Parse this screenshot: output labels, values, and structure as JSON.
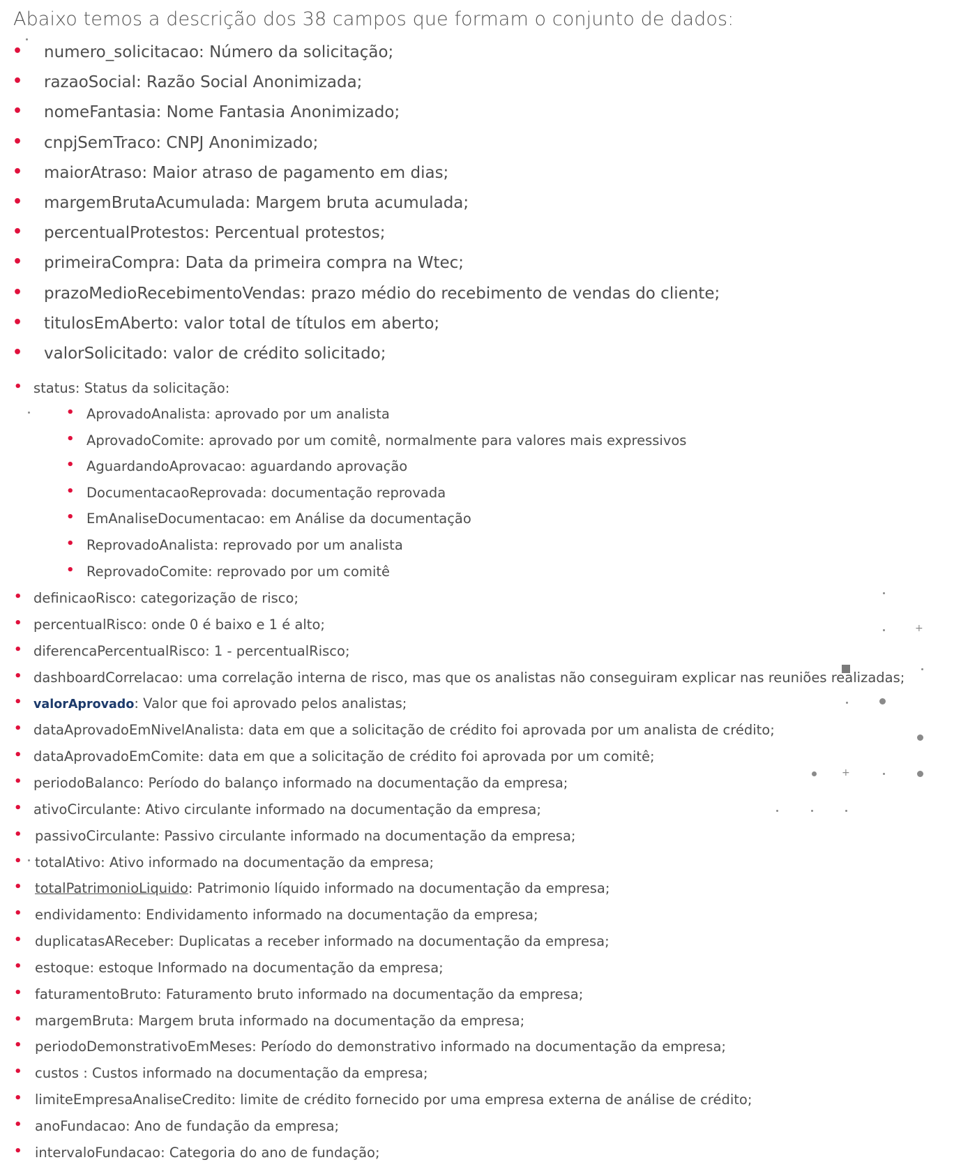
{
  "title": "Abaixo temos a descrição dos 38 campos que formam o conjunto de dados:",
  "main_fields": [
    {
      "key": "numero_solicitacao",
      "desc": ": Número da solicitação;"
    },
    {
      "key": "razaoSocial",
      "desc": ": Razão Social Anonimizada;"
    },
    {
      "key": "nomeFantasia",
      "desc": ": Nome Fantasia Anonimizado;"
    },
    {
      "key": "cnpjSemTraco",
      "desc": ": CNPJ Anonimizado;"
    },
    {
      "key": "maiorAtraso",
      "desc": ": Maior atraso de pagamento em dias;"
    },
    {
      "key": "margemBrutaAcumulada",
      "desc": ": Margem bruta acumulada;"
    },
    {
      "key": "percentualProtestos",
      "desc": ": Percentual protestos;"
    },
    {
      "key": "primeiraCompra",
      "desc": ": Data da primeira compra na Wtec;"
    },
    {
      "key": "prazoMedioRecebimentoVendas",
      "desc": ": prazo médio do recebimento de vendas do cliente;"
    },
    {
      "key": "titulosEmAberto",
      "desc": ": valor total de títulos em aberto;"
    },
    {
      "key": "valorSolicitado",
      "desc": ": valor de crédito solicitado;"
    }
  ],
  "status": {
    "key": "status",
    "desc": ": Status da solicitação:"
  },
  "status_items": [
    {
      "key": "AprovadoAnalista",
      "desc": ": aprovado por um analista"
    },
    {
      "key": "AprovadoComite",
      "desc": ": aprovado por um comitê, normalmente para valores mais expressivos"
    },
    {
      "key": "AguardandoAprovacao",
      "desc": ": aguardando aprovação"
    },
    {
      "key": "DocumentacaoReprovada",
      "desc": ": documentação reprovada"
    },
    {
      "key": "EmAnaliseDocumentacao",
      "desc": ": em Análise da documentação"
    },
    {
      "key": "ReprovadoAnalista",
      "desc": ": reprovado por um analista"
    },
    {
      "key": "ReprovadoComite",
      "desc": ": reprovado por um comitê"
    }
  ],
  "other_fields": [
    {
      "key": "definicaoRisco",
      "desc": ": categorização de risco;"
    },
    {
      "key": "percentualRisco",
      "desc": ": onde 0 é baixo e 1 é alto;"
    },
    {
      "key": "diferencaPercentualRisco",
      "desc": ": 1 - percentualRisco;"
    },
    {
      "key": "dashboardCorrelacao",
      "desc": ": uma correlação interna de risco, mas que os analistas não conseguiram explicar nas reuniões realizadas;"
    },
    {
      "key": "valorAprovado",
      "desc": ": Valor que foi aprovado pelos analistas;"
    },
    {
      "key": "dataAprovadoEmNivelAnalista",
      "desc": ": data em que a solicitação de crédito foi aprovada por um analista de crédito;"
    },
    {
      "key": "dataAprovadoEmComite",
      "desc": ": data em que a solicitação de crédito foi aprovada por um comitê;"
    },
    {
      "key": "periodoBalanco",
      "desc": ": Período do balanço informado na documentação da empresa;"
    },
    {
      "key": "ativoCirculante",
      "desc": ": Ativo circulante informado na documentação da empresa;"
    },
    {
      "key": "passivoCirculante",
      "desc": ": Passivo circulante informado na documentação da empresa;"
    },
    {
      "key": "totalAtivo",
      "desc": ": Ativo informado na documentação da empresa;"
    },
    {
      "key": "totalPatrimonioLiquido",
      "desc": ": Patrimonio líquido informado na documentação da empresa;"
    },
    {
      "key": "endividamento",
      "desc": ": Endividamento informado na documentação da empresa;"
    },
    {
      "key": "duplicatasAReceber",
      "desc": ": Duplicatas a receber informado na documentação da empresa;"
    },
    {
      "key": "estoque",
      "desc": ": estoque Informado na documentação da empresa;"
    },
    {
      "key": "faturamentoBruto",
      "desc": ": Faturamento bruto informado na documentação da empresa;"
    },
    {
      "key": "margemBruta",
      "desc": ": Margem bruta informado na documentação da empresa;"
    },
    {
      "key": "periodoDemonstrativoEmMeses",
      "desc": ": Período do demonstrativo informado na documentação da empresa;"
    },
    {
      "key": "custos ",
      "desc": ": Custos informado na documentação da empresa;"
    },
    {
      "key": "limiteEmpresaAnaliseCredito",
      "desc": ": limite de crédito fornecido por uma empresa externa de análise de crédito;"
    },
    {
      "key": "anoFundacao",
      "desc": ": Ano de fundação da empresa;"
    },
    {
      "key": "intervaloFundacao",
      "desc": ": Categoria do ano de fundação;"
    }
  ],
  "bullet_char": "•",
  "colors": {
    "bullet": "#e0103c",
    "text": "#4d4d4d",
    "highlight_key": "#1c3a6b"
  }
}
